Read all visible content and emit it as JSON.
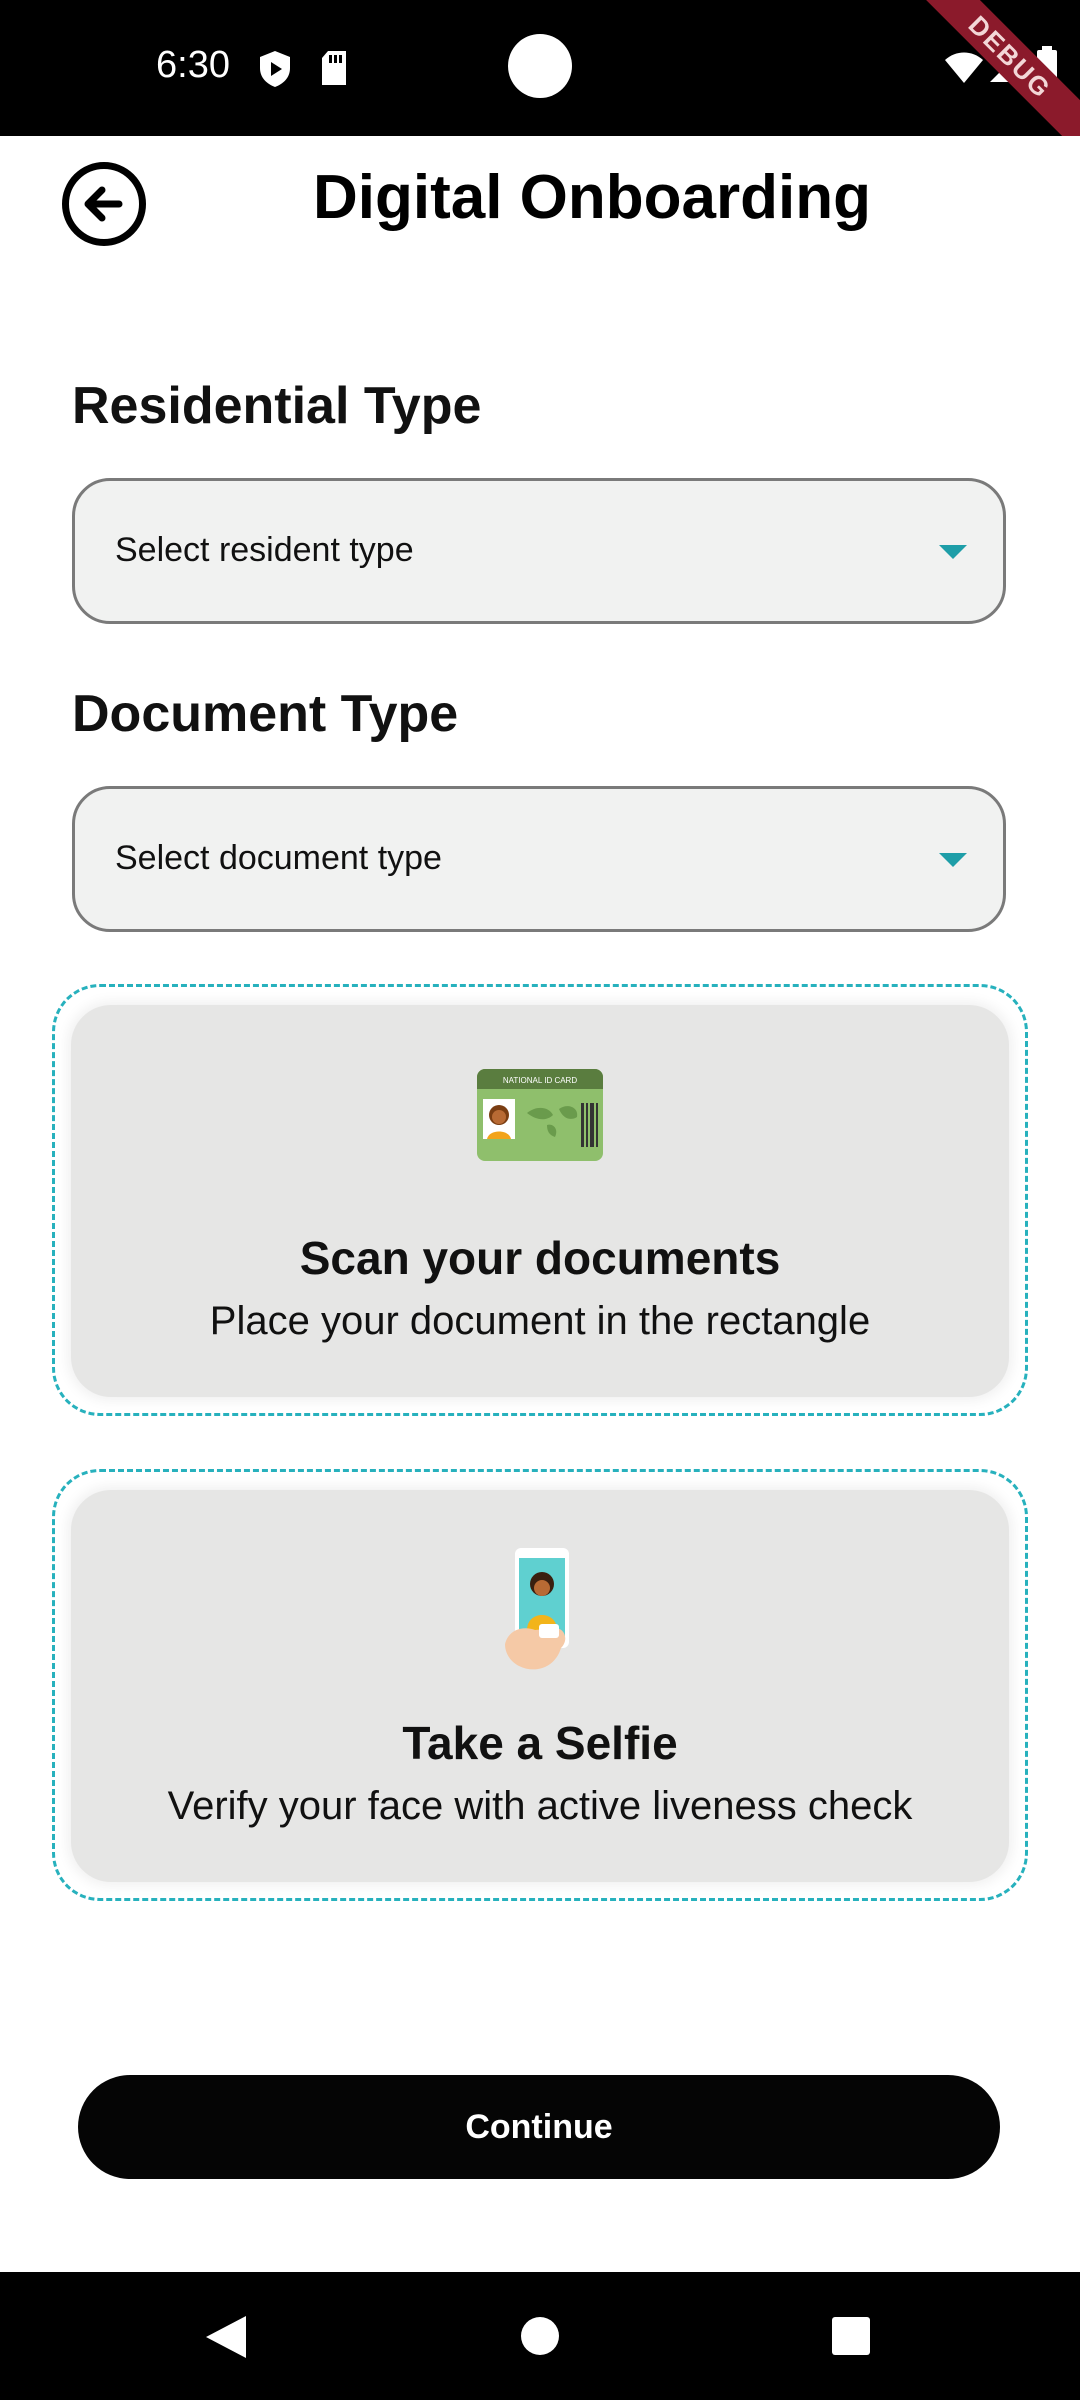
{
  "status_bar": {
    "time": "6:30",
    "icons": [
      "shield-play-icon",
      "sd-card-icon",
      "wifi-icon",
      "signal-icon",
      "battery-icon"
    ],
    "debug_banner": "DEBUG"
  },
  "header": {
    "title": "Digital Onboarding",
    "back_icon": "arrow-left-circle-icon"
  },
  "residential": {
    "label": "Residential Type",
    "placeholder": "Select resident type"
  },
  "document": {
    "label": "Document Type",
    "placeholder": "Select document type"
  },
  "scan_card": {
    "title": "Scan your documents",
    "subtitle": "Place your document in the rectangle",
    "illustration_label": "NATIONAL ID CARD"
  },
  "selfie_card": {
    "title": "Take a Selfie",
    "subtitle": "Verify your face with active liveness check"
  },
  "continue_label": "Continue",
  "colors": {
    "accent": "#1e9ea8",
    "dashed_border": "#27b1bd",
    "card_bg": "#e6e6e5",
    "select_bg": "#f1f2f1",
    "button_bg": "#050505"
  },
  "nav_bar": {
    "icons": [
      "back-triangle-icon",
      "home-circle-icon",
      "recents-square-icon"
    ]
  }
}
